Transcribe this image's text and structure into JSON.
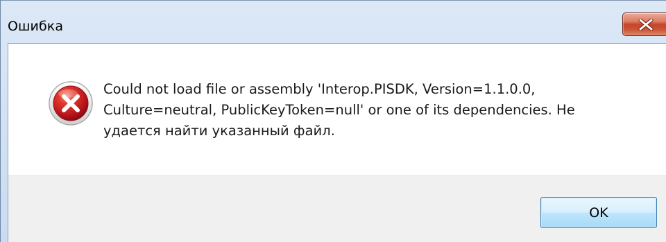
{
  "window": {
    "title": "Ошибка",
    "close_icon": "close-x-icon"
  },
  "message": {
    "icon": "error-icon",
    "text": "Could not load file or assembly 'Interop.PISDK, Version=1.1.0.0,\nCulture=neutral, PublicKeyToken=null' or one of its dependencies. Не\nудается найти указанный файл."
  },
  "buttons": {
    "ok_label": "OK"
  },
  "colors": {
    "close_button": "#c5452a",
    "error_icon": "#c4161c",
    "titlebar": "#dce8f6",
    "button_bar": "#f0f0f0",
    "ok_button_border": "#3c7fb1"
  }
}
